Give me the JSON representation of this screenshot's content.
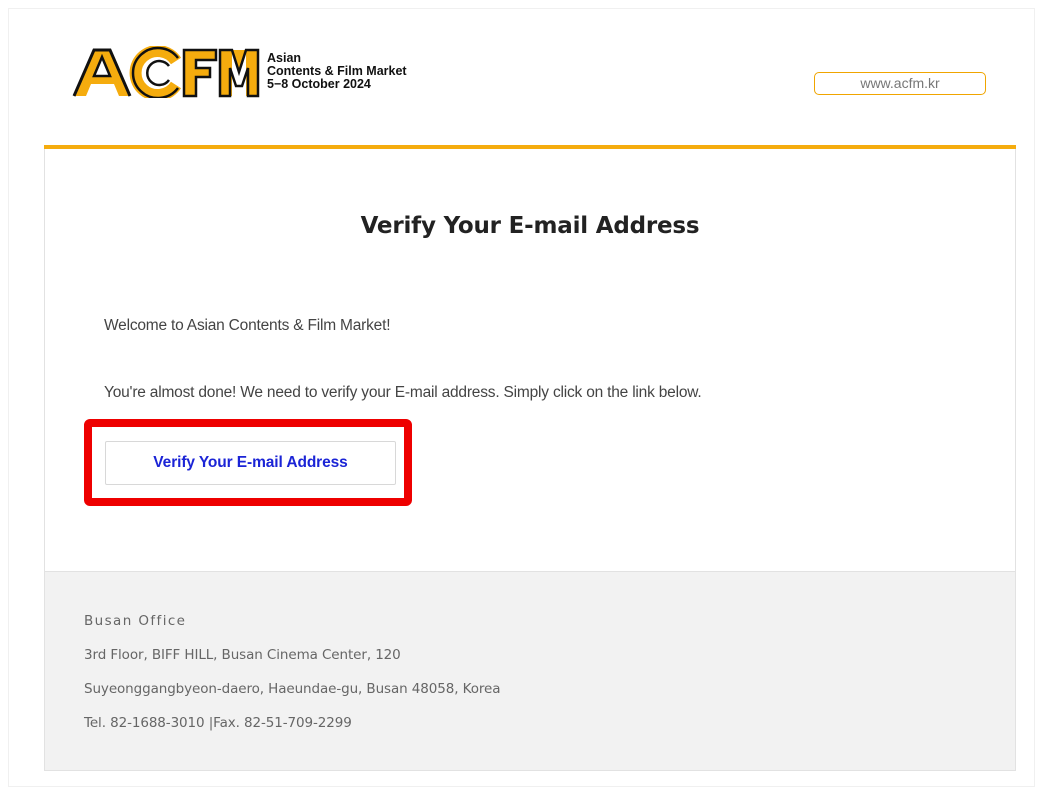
{
  "header": {
    "logo_wordmark": "ACFM",
    "logo_lines": [
      "Asian",
      "Contents & Film Market",
      "5−8 October 2024"
    ],
    "site_link": "www.acfm.kr",
    "accent_color": "#f5ac0e"
  },
  "main": {
    "title": "Verify Your E-mail Address",
    "welcome": "Welcome to Asian Contents & Film Market!",
    "instruction": "You're almost done! We need to verify your E-mail address. Simply click on the link below.",
    "verify_button_label": "Verify Your E-mail  Address",
    "highlight_color": "#ee0000"
  },
  "footer": {
    "office": "Busan Office",
    "address_line1": "3rd Floor, BIFF HILL, Busan Cinema Center, 120",
    "address_line2": "Suyeonggangbyeon-daero, Haeundae-gu, Busan 48058, Korea",
    "contact": "Tel. 82-1688-3010 |Fax. 82-51-709-2299"
  }
}
